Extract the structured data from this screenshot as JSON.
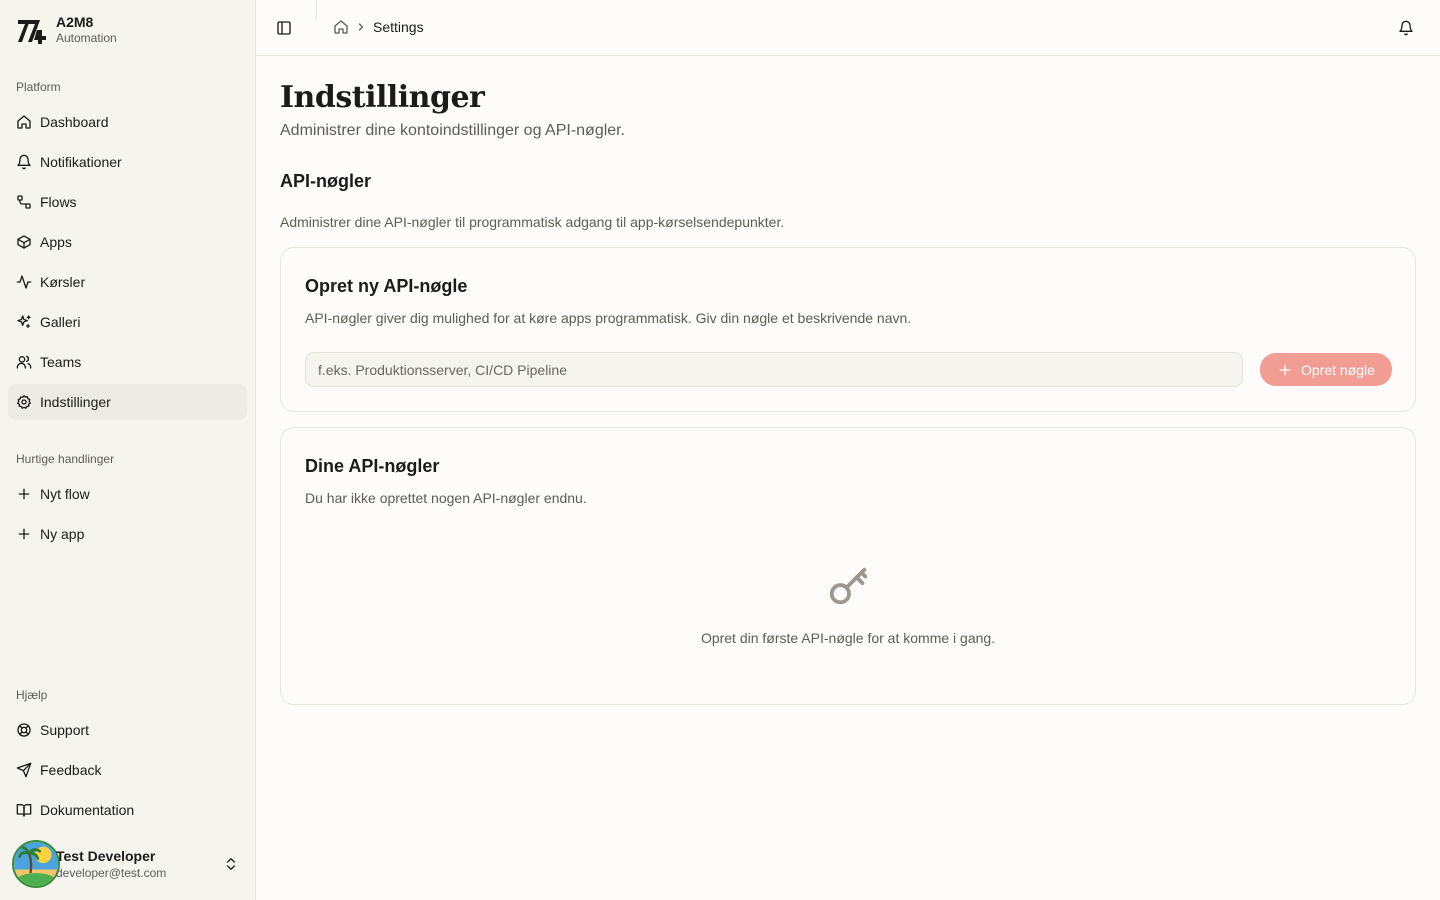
{
  "brand": {
    "name": "A2M8",
    "subtitle": "Automation"
  },
  "sidebar": {
    "platform_label": "Platform",
    "platform_items": [
      {
        "label": "Dashboard",
        "icon": "home-icon"
      },
      {
        "label": "Notifikationer",
        "icon": "bell-icon"
      },
      {
        "label": "Flows",
        "icon": "flow-icon"
      },
      {
        "label": "Apps",
        "icon": "box-icon"
      },
      {
        "label": "Kørsler",
        "icon": "activity-icon"
      },
      {
        "label": "Galleri",
        "icon": "sparkles-icon"
      },
      {
        "label": "Teams",
        "icon": "users-icon"
      },
      {
        "label": "Indstillinger",
        "icon": "gear-icon",
        "active": true
      }
    ],
    "quick_label": "Hurtige handlinger",
    "quick_items": [
      {
        "label": "Nyt flow",
        "icon": "plus-icon"
      },
      {
        "label": "Ny app",
        "icon": "plus-icon"
      }
    ],
    "help_label": "Hjælp",
    "help_items": [
      {
        "label": "Support",
        "icon": "lifebuoy-icon"
      },
      {
        "label": "Feedback",
        "icon": "send-icon"
      },
      {
        "label": "Dokumentation",
        "icon": "book-icon"
      }
    ],
    "user": {
      "name": "Test Developer",
      "email": "developer@test.com"
    }
  },
  "header": {
    "breadcrumb_current": "Settings"
  },
  "main": {
    "title": "Indstillinger",
    "subtitle": "Administrer dine kontoindstillinger og API-nøgler.",
    "section_title": "API-nøgler",
    "section_desc": "Administrer dine API-nøgler til programmatisk adgang til app-kørselsendepunkter.",
    "create_card": {
      "title": "Opret ny API-nøgle",
      "desc": "API-nøgler giver dig mulighed for at køre apps programmatisk. Giv din nøgle et beskrivende navn.",
      "input_placeholder": "f.eks. Produktionsserver, CI/CD Pipeline",
      "input_value": "",
      "button_label": "Opret nøgle"
    },
    "keys_card": {
      "title": "Dine API-nøgler",
      "desc": "Du har ikke oprettet nogen API-nøgler endnu.",
      "empty_text": "Opret din første API-nøgle for at komme i gang."
    }
  },
  "colors": {
    "accent_button": "#f29d94",
    "sidebar_bg": "#f6f4ef",
    "page_bg": "#fdfcfa"
  }
}
